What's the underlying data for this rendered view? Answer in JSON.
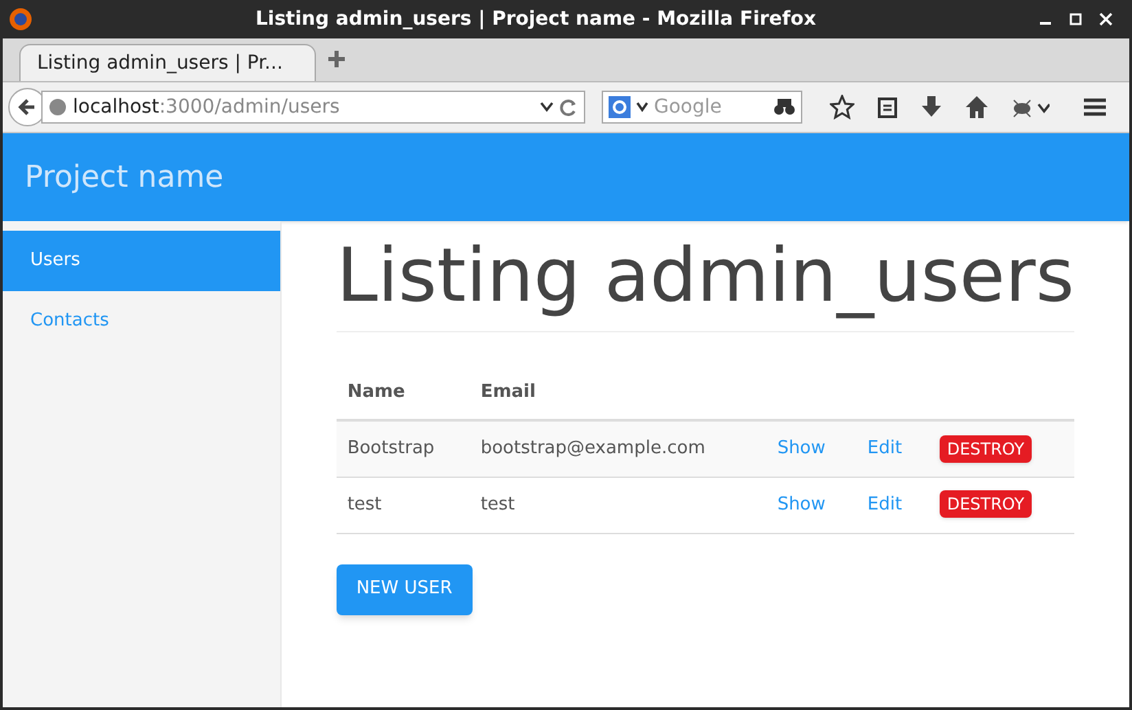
{
  "window": {
    "title": "Listing admin_users | Project name - Mozilla Firefox"
  },
  "tabs": [
    {
      "label": "Listing admin_users | Pr...",
      "selected": true
    }
  ],
  "address_bar": {
    "host": "localhost",
    "path": ":3000/admin/users"
  },
  "search": {
    "placeholder": "Google"
  },
  "brand": "Project name",
  "sidebar": {
    "items": [
      {
        "label": "Users",
        "selected": true
      },
      {
        "label": "Contacts",
        "selected": false
      }
    ]
  },
  "heading": "Listing admin_users",
  "table": {
    "columns": [
      "Name",
      "Email"
    ],
    "rows": [
      {
        "name": "Bootstrap",
        "email": "bootstrap@example.com",
        "actions": [
          "Show",
          "Edit",
          "DESTROY"
        ]
      },
      {
        "name": "test",
        "email": "test",
        "actions": [
          "Show",
          "Edit",
          "DESTROY"
        ]
      }
    ]
  },
  "new_button": "NEW USER"
}
